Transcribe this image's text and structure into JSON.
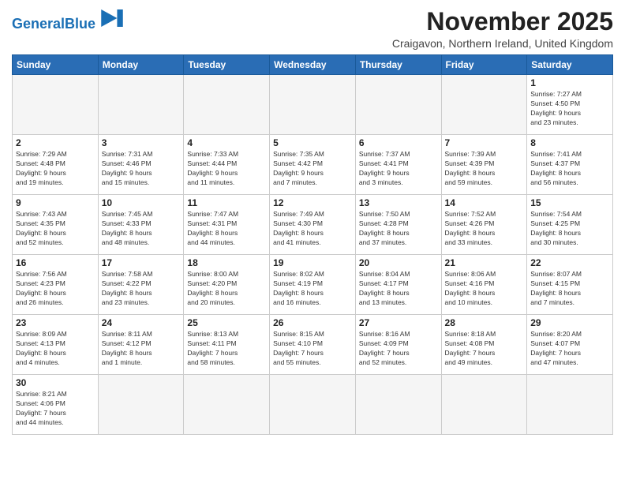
{
  "header": {
    "logo_general": "General",
    "logo_blue": "Blue",
    "title": "November 2025",
    "subtitle": "Craigavon, Northern Ireland, United Kingdom"
  },
  "weekdays": [
    "Sunday",
    "Monday",
    "Tuesday",
    "Wednesday",
    "Thursday",
    "Friday",
    "Saturday"
  ],
  "weeks": [
    [
      {
        "day": "",
        "empty": true
      },
      {
        "day": "",
        "empty": true
      },
      {
        "day": "",
        "empty": true
      },
      {
        "day": "",
        "empty": true
      },
      {
        "day": "",
        "empty": true
      },
      {
        "day": "",
        "empty": true
      },
      {
        "day": "1",
        "info": "Sunrise: 7:27 AM\nSunset: 4:50 PM\nDaylight: 9 hours\nand 23 minutes."
      }
    ],
    [
      {
        "day": "2",
        "info": "Sunrise: 7:29 AM\nSunset: 4:48 PM\nDaylight: 9 hours\nand 19 minutes."
      },
      {
        "day": "3",
        "info": "Sunrise: 7:31 AM\nSunset: 4:46 PM\nDaylight: 9 hours\nand 15 minutes."
      },
      {
        "day": "4",
        "info": "Sunrise: 7:33 AM\nSunset: 4:44 PM\nDaylight: 9 hours\nand 11 minutes."
      },
      {
        "day": "5",
        "info": "Sunrise: 7:35 AM\nSunset: 4:42 PM\nDaylight: 9 hours\nand 7 minutes."
      },
      {
        "day": "6",
        "info": "Sunrise: 7:37 AM\nSunset: 4:41 PM\nDaylight: 9 hours\nand 3 minutes."
      },
      {
        "day": "7",
        "info": "Sunrise: 7:39 AM\nSunset: 4:39 PM\nDaylight: 8 hours\nand 59 minutes."
      },
      {
        "day": "8",
        "info": "Sunrise: 7:41 AM\nSunset: 4:37 PM\nDaylight: 8 hours\nand 56 minutes."
      }
    ],
    [
      {
        "day": "9",
        "info": "Sunrise: 7:43 AM\nSunset: 4:35 PM\nDaylight: 8 hours\nand 52 minutes."
      },
      {
        "day": "10",
        "info": "Sunrise: 7:45 AM\nSunset: 4:33 PM\nDaylight: 8 hours\nand 48 minutes."
      },
      {
        "day": "11",
        "info": "Sunrise: 7:47 AM\nSunset: 4:31 PM\nDaylight: 8 hours\nand 44 minutes."
      },
      {
        "day": "12",
        "info": "Sunrise: 7:49 AM\nSunset: 4:30 PM\nDaylight: 8 hours\nand 41 minutes."
      },
      {
        "day": "13",
        "info": "Sunrise: 7:50 AM\nSunset: 4:28 PM\nDaylight: 8 hours\nand 37 minutes."
      },
      {
        "day": "14",
        "info": "Sunrise: 7:52 AM\nSunset: 4:26 PM\nDaylight: 8 hours\nand 33 minutes."
      },
      {
        "day": "15",
        "info": "Sunrise: 7:54 AM\nSunset: 4:25 PM\nDaylight: 8 hours\nand 30 minutes."
      }
    ],
    [
      {
        "day": "16",
        "info": "Sunrise: 7:56 AM\nSunset: 4:23 PM\nDaylight: 8 hours\nand 26 minutes."
      },
      {
        "day": "17",
        "info": "Sunrise: 7:58 AM\nSunset: 4:22 PM\nDaylight: 8 hours\nand 23 minutes."
      },
      {
        "day": "18",
        "info": "Sunrise: 8:00 AM\nSunset: 4:20 PM\nDaylight: 8 hours\nand 20 minutes."
      },
      {
        "day": "19",
        "info": "Sunrise: 8:02 AM\nSunset: 4:19 PM\nDaylight: 8 hours\nand 16 minutes."
      },
      {
        "day": "20",
        "info": "Sunrise: 8:04 AM\nSunset: 4:17 PM\nDaylight: 8 hours\nand 13 minutes."
      },
      {
        "day": "21",
        "info": "Sunrise: 8:06 AM\nSunset: 4:16 PM\nDaylight: 8 hours\nand 10 minutes."
      },
      {
        "day": "22",
        "info": "Sunrise: 8:07 AM\nSunset: 4:15 PM\nDaylight: 8 hours\nand 7 minutes."
      }
    ],
    [
      {
        "day": "23",
        "info": "Sunrise: 8:09 AM\nSunset: 4:13 PM\nDaylight: 8 hours\nand 4 minutes."
      },
      {
        "day": "24",
        "info": "Sunrise: 8:11 AM\nSunset: 4:12 PM\nDaylight: 8 hours\nand 1 minute."
      },
      {
        "day": "25",
        "info": "Sunrise: 8:13 AM\nSunset: 4:11 PM\nDaylight: 7 hours\nand 58 minutes."
      },
      {
        "day": "26",
        "info": "Sunrise: 8:15 AM\nSunset: 4:10 PM\nDaylight: 7 hours\nand 55 minutes."
      },
      {
        "day": "27",
        "info": "Sunrise: 8:16 AM\nSunset: 4:09 PM\nDaylight: 7 hours\nand 52 minutes."
      },
      {
        "day": "28",
        "info": "Sunrise: 8:18 AM\nSunset: 4:08 PM\nDaylight: 7 hours\nand 49 minutes."
      },
      {
        "day": "29",
        "info": "Sunrise: 8:20 AM\nSunset: 4:07 PM\nDaylight: 7 hours\nand 47 minutes."
      }
    ],
    [
      {
        "day": "30",
        "info": "Sunrise: 8:21 AM\nSunset: 4:06 PM\nDaylight: 7 hours\nand 44 minutes."
      },
      {
        "day": "",
        "empty": true
      },
      {
        "day": "",
        "empty": true
      },
      {
        "day": "",
        "empty": true
      },
      {
        "day": "",
        "empty": true
      },
      {
        "day": "",
        "empty": true
      },
      {
        "day": "",
        "empty": true
      }
    ]
  ]
}
